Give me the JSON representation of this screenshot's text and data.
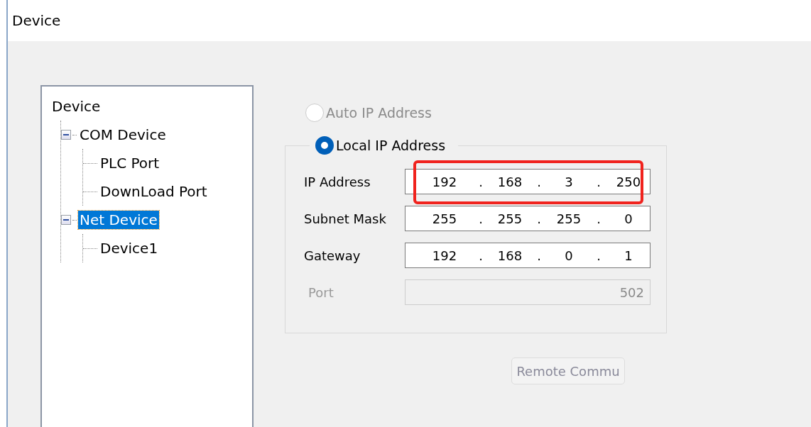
{
  "window": {
    "title": "Device"
  },
  "tree": {
    "label": "Device",
    "children": [
      {
        "label": "COM Device",
        "expanded": true,
        "selected": false,
        "children": [
          {
            "label": "PLC Port",
            "selected": false
          },
          {
            "label": "DownLoad Port",
            "selected": false
          }
        ]
      },
      {
        "label": "Net Device",
        "expanded": true,
        "selected": true,
        "children": [
          {
            "label": "Device1",
            "selected": false
          }
        ]
      }
    ]
  },
  "auto_ip": {
    "label": "Auto IP Address",
    "selected": false,
    "disabled": true
  },
  "local_ip": {
    "label": "Local IP Address",
    "selected": true
  },
  "separator": ".",
  "fields": [
    {
      "label": "IP Address",
      "octets": [
        "192",
        "168",
        "3",
        "250"
      ],
      "highlighted": true
    },
    {
      "label": "Subnet Mask",
      "octets": [
        "255",
        "255",
        "255",
        "0"
      ],
      "highlighted": false
    },
    {
      "label": "Gateway",
      "octets": [
        "192",
        "168",
        "0",
        "1"
      ],
      "highlighted": false
    }
  ],
  "port": {
    "label": "Port",
    "value": "502",
    "disabled": true
  },
  "button": {
    "label": "Remote Commu",
    "disabled": true
  }
}
